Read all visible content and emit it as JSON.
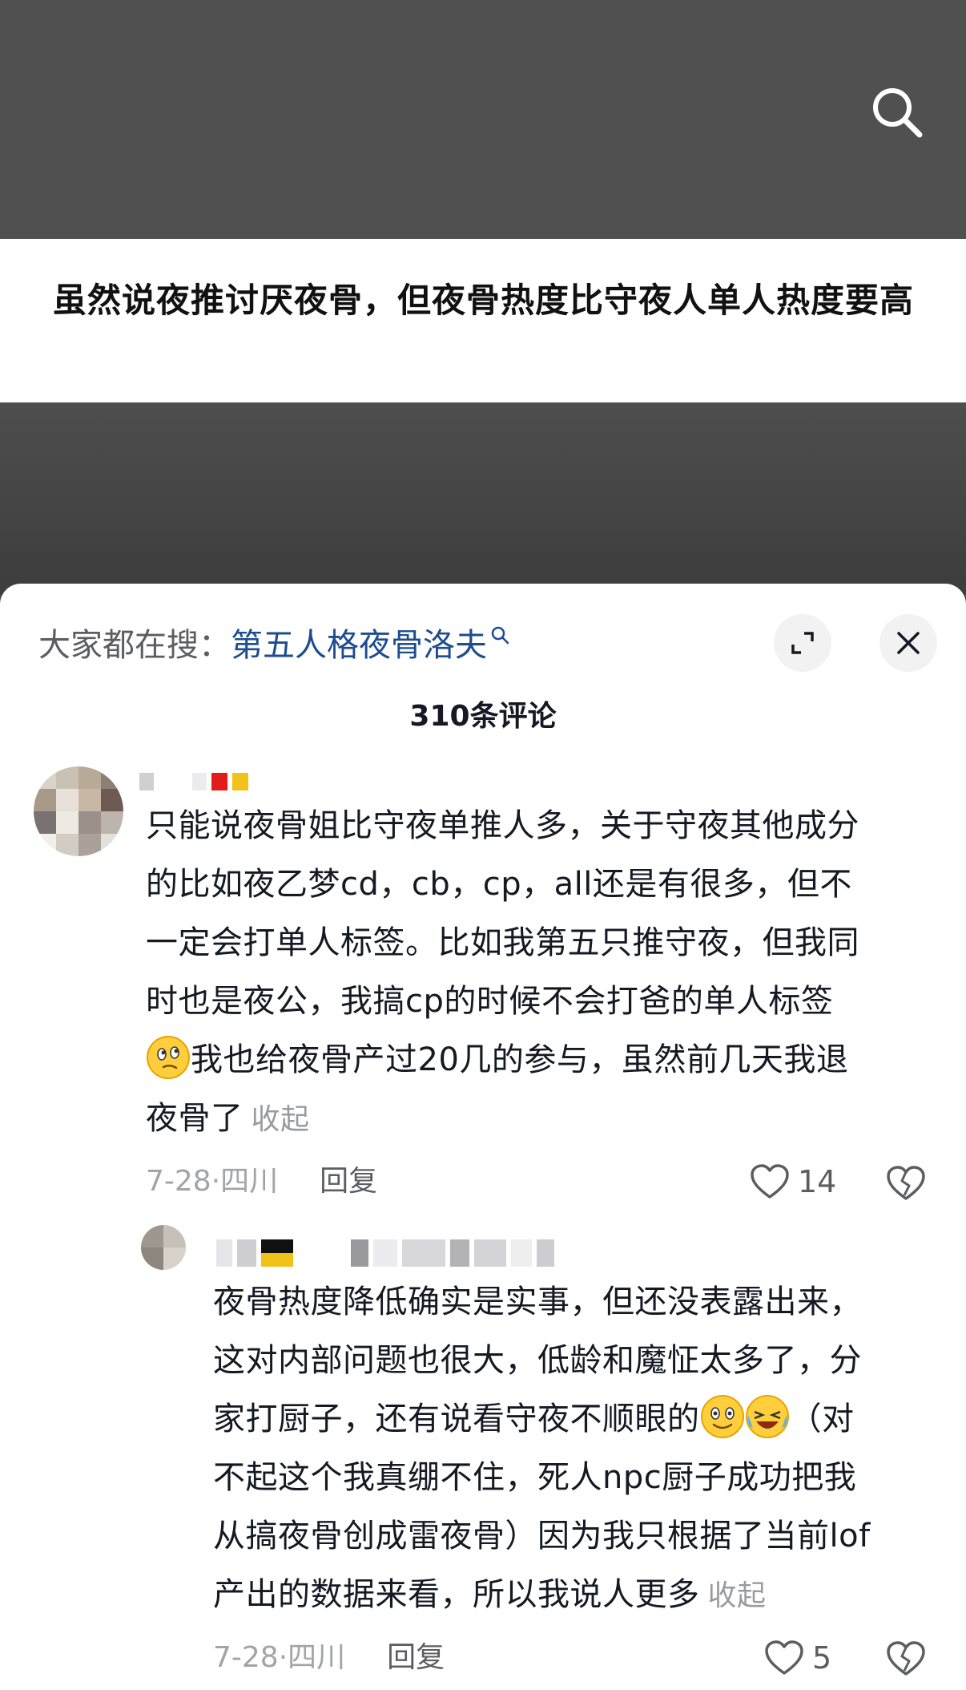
{
  "video": {
    "title": "虽然说夜推讨厌夜骨，但夜骨热度比守夜人单人热度要高"
  },
  "panel": {
    "hot_search_prefix": "大家都在搜：",
    "hot_search_keyword": "第五人格夜骨洛夫",
    "comment_count": "310条评论"
  },
  "comments": [
    {
      "text_lines": [
        "只能说夜骨姐比守夜单推人多，关于守夜其他成分",
        "的比如夜乙梦cd，cb，cp，all还是有很多，但不",
        "一定会打单人标签。比如我第五只推守夜，但我同",
        "时也是夜公，我搞cp的时候不会打爸的单人标签"
      ],
      "line5_text": "我也给夜骨产过20几的参与，虽然前几天我退",
      "line6_text": "夜骨了",
      "collapse": "收起",
      "date": "7-28",
      "location": "四川",
      "reply": "回复",
      "likes": "14",
      "emoji_icon": "thinking-face-icon"
    },
    {
      "line1_text": "夜骨热度降低确实是实事，但还没表露出来，",
      "line2_text": "这对内部问题也很大，低龄和魔怔太多了，分",
      "line3_text": "家打厨子，还有说看守夜不顺眼的",
      "line3_tail": "（对",
      "line4_text": "不起这个我真绷不住，死人npc厨子成功把我",
      "line5_text": "从搞夜骨创成雷夜骨）因为我只根据了当前lof",
      "line6_text": "产出的数据来看，所以我说人更多",
      "collapse": "收起",
      "date": "7-28",
      "location": "四川",
      "reply": "回复",
      "likes": "5",
      "emoji_icons": [
        "smiling-face-icon",
        "laughing-crying-face-icon"
      ]
    }
  ],
  "colors": {
    "link": "#1d4c8f",
    "muted": "#a3a4a9",
    "text": "#161823"
  }
}
